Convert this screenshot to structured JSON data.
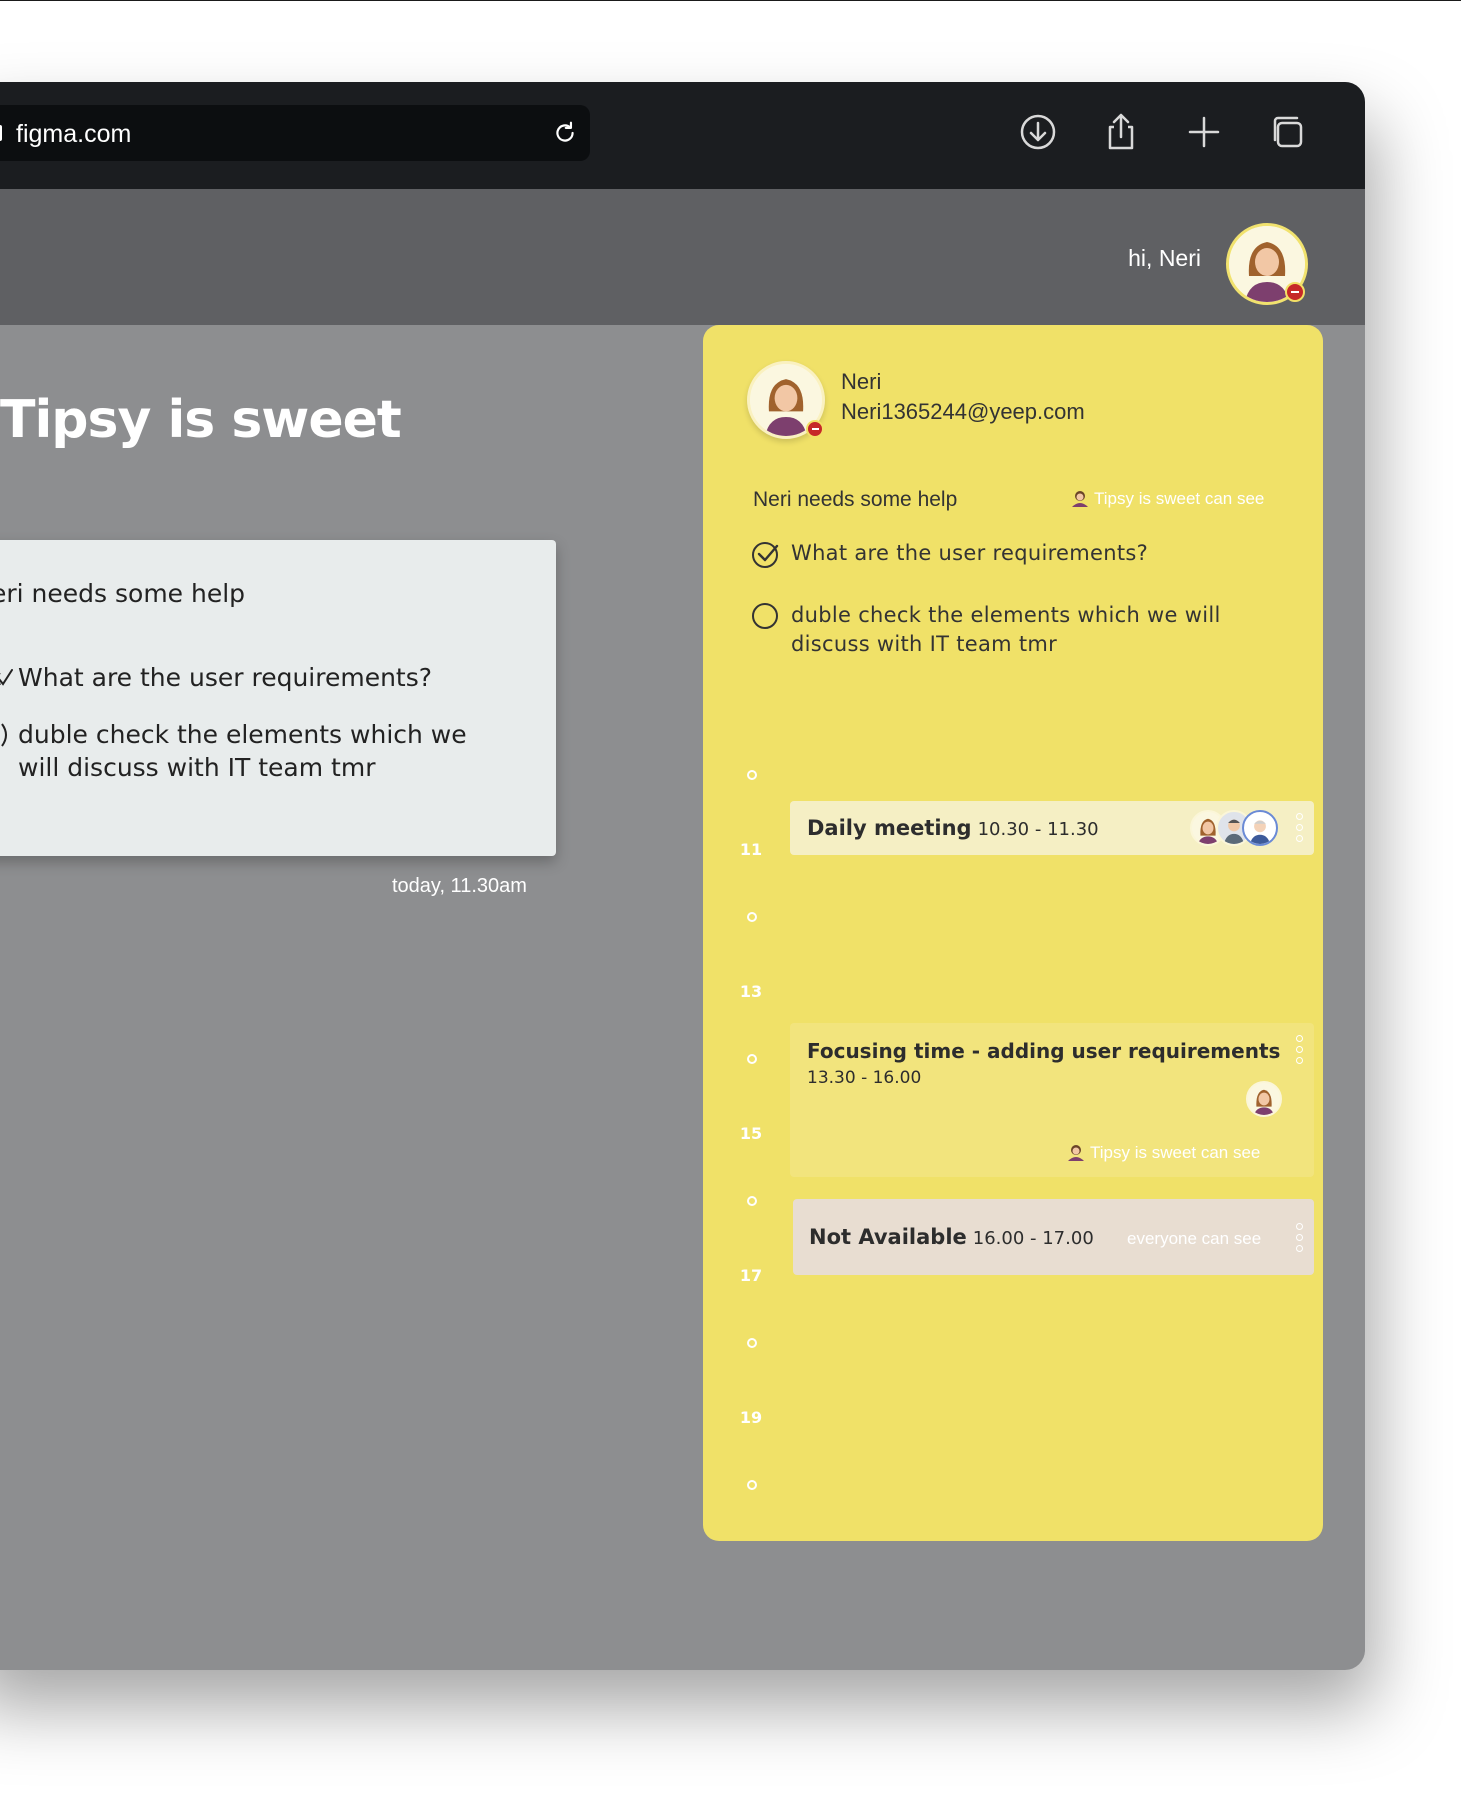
{
  "browser": {
    "url": "figma.com",
    "toolbar_icons": [
      "download-icon",
      "share-icon",
      "plus-icon",
      "tabs-icon"
    ]
  },
  "header": {
    "greeting": "hi, Neri"
  },
  "channel": {
    "title": "Tipsy is sweet",
    "note": {
      "heading": "eri needs some help",
      "items": [
        {
          "text": "What are the user requirements?",
          "done": true
        },
        {
          "text": "duble check the elements which we will discuss with IT team tmr",
          "done": false
        }
      ]
    },
    "timestamp": "today, 11.30am"
  },
  "panel": {
    "user": {
      "name": "Neri",
      "email": "Neri1365244@yeep.com"
    },
    "help_title": "Neri needs some help",
    "help_visibility": "Tipsy is sweet can see",
    "todos": [
      {
        "text": "What are the user requirements?",
        "done": true
      },
      {
        "text": "duble check the elements which we will discuss with IT team tmr",
        "done": false
      }
    ],
    "hours": [
      "11",
      "13",
      "15",
      "17",
      "19"
    ],
    "events": [
      {
        "title": "Daily meeting",
        "time": "10.30 - 11.30"
      },
      {
        "title": "Focusing time - adding user requirements",
        "time": "13.30 - 16.00",
        "visibility": "Tipsy is sweet can see"
      },
      {
        "title": "Not Available",
        "time": "16.00 - 17.00",
        "visibility": "everyone can see"
      }
    ]
  },
  "colors": {
    "panel": "#f0e168",
    "status_busy": "#c62828",
    "toolbar": "#1b1d20"
  }
}
